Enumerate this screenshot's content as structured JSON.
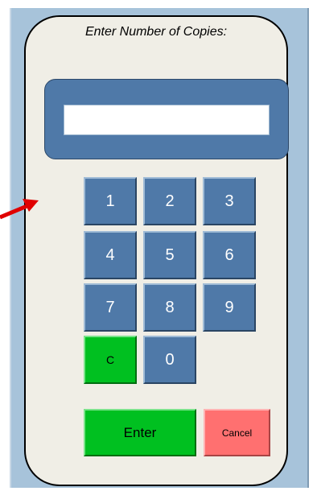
{
  "dialog": {
    "title": "Enter Number of Copies:",
    "input_value": ""
  },
  "keypad": {
    "keys": [
      "1",
      "2",
      "3",
      "4",
      "5",
      "6",
      "7",
      "8",
      "9",
      "C",
      "0"
    ]
  },
  "actions": {
    "enter_label": "Enter",
    "cancel_label": "Cancel"
  },
  "colors": {
    "key_blue": "#4f79a8",
    "green": "#00c020",
    "cancel_red": "#ff7070",
    "panel_beige": "#f0eee6",
    "arrow_red": "#e00000"
  },
  "icons": {
    "pointer": "red-arrow-icon"
  }
}
